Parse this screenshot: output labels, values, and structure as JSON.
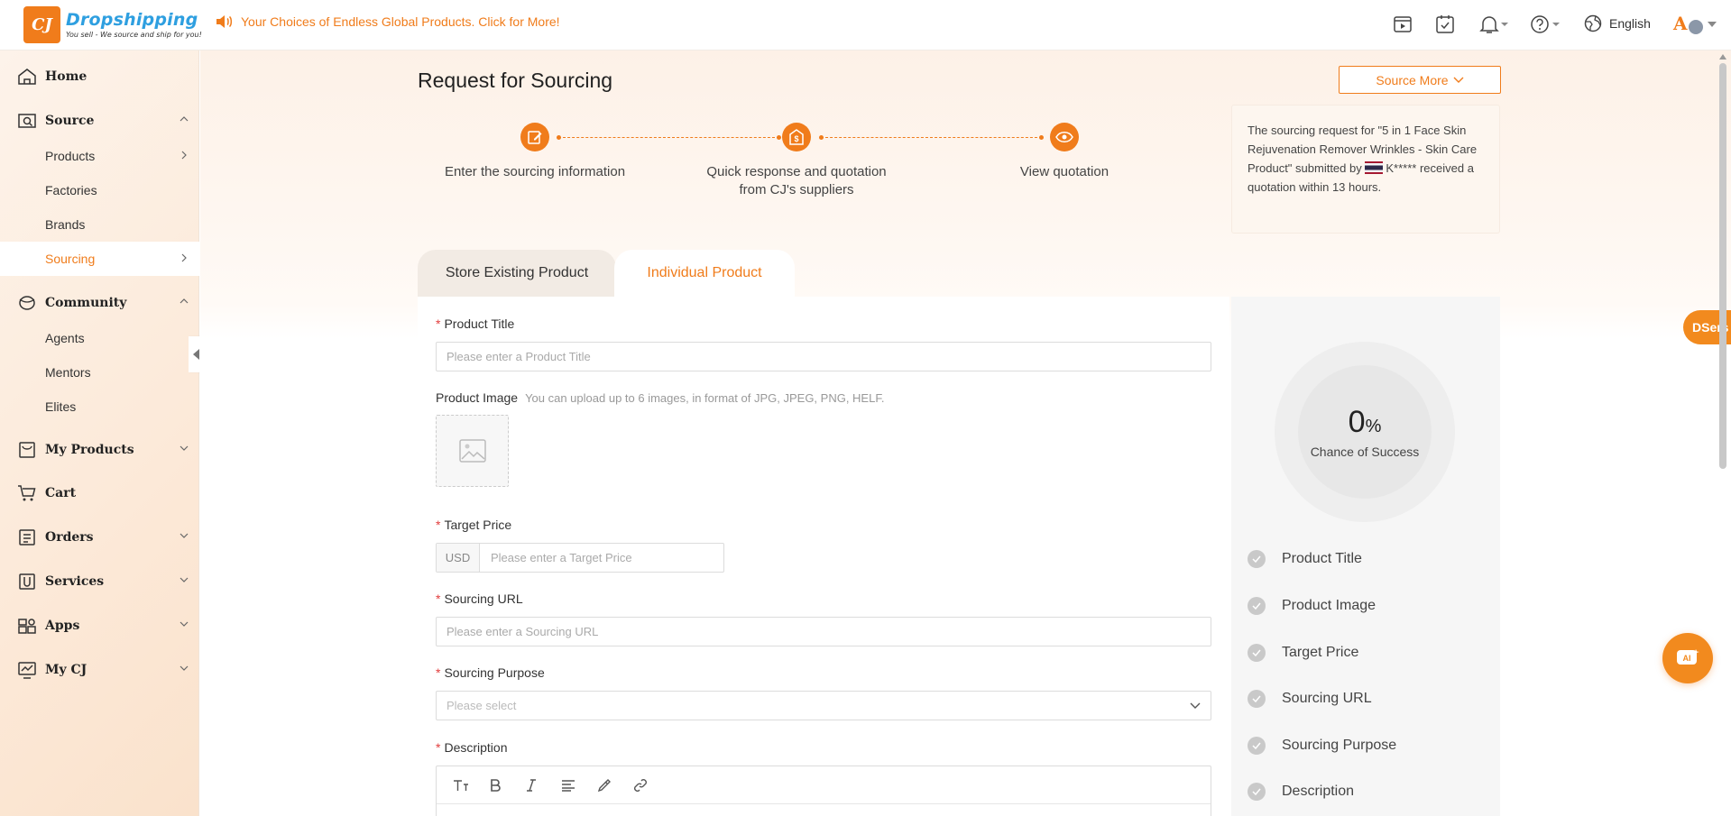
{
  "header": {
    "logo_mark": "CJ",
    "logo_title": "Dropshipping",
    "logo_subtitle": "You sell - We source and ship for you!",
    "announcement": "Your Choices of Endless Global Products. Click for More!",
    "language": "English",
    "avatar_letter": "A"
  },
  "sidebar": {
    "items": [
      {
        "label": "Home"
      },
      {
        "label": "Source"
      },
      {
        "label": "Products"
      },
      {
        "label": "Factories"
      },
      {
        "label": "Brands"
      },
      {
        "label": "Sourcing"
      },
      {
        "label": "Community"
      },
      {
        "label": "Agents"
      },
      {
        "label": "Mentors"
      },
      {
        "label": "Elites"
      },
      {
        "label": "My Products"
      },
      {
        "label": "Cart"
      },
      {
        "label": "Orders"
      },
      {
        "label": "Services"
      },
      {
        "label": "Apps"
      },
      {
        "label": "My CJ"
      }
    ],
    "active_item": "Sourcing"
  },
  "page": {
    "title": "Request for Sourcing",
    "source_more": "Source More",
    "steps": [
      {
        "line1": "Enter the sourcing information",
        "line2": ""
      },
      {
        "line1": "Quick response and quotation",
        "line2": "from CJ's suppliers"
      },
      {
        "line1": "View quotation",
        "line2": ""
      }
    ],
    "notice": {
      "before_flag": "The sourcing request for \"5 in 1 Face Skin Rejuvenation Remover Wrinkles - Skin Care Product\" submitted by",
      "user": "K*****",
      "after": "received a quotation within 13 hours."
    },
    "tabs": [
      {
        "label": "Store Existing Product",
        "active": false
      },
      {
        "label": "Individual Product",
        "active": true
      }
    ]
  },
  "form": {
    "product_title": {
      "label": "Product Title",
      "placeholder": "Please enter a Product Title"
    },
    "product_image": {
      "label": "Product Image",
      "hint": "You can upload up to 6 images, in format of JPG, JPEG, PNG, HELF."
    },
    "target_price": {
      "label": "Target Price",
      "currency": "USD",
      "placeholder": "Please enter a Target Price"
    },
    "sourcing_url": {
      "label": "Sourcing URL",
      "placeholder": "Please enter a Sourcing URL"
    },
    "sourcing_purpose": {
      "label": "Sourcing Purpose",
      "placeholder": "Please select"
    },
    "description": {
      "label": "Description"
    },
    "required_mark": "*"
  },
  "progress": {
    "value": "0",
    "unit": "%",
    "label": "Chance of Success",
    "checklist": [
      "Product Title",
      "Product Image",
      "Target Price",
      "Sourcing URL",
      "Sourcing Purpose",
      "Description"
    ]
  },
  "floating": {
    "dsers": "DSers",
    "ai": "AI"
  },
  "colors": {
    "accent": "#f07c1b",
    "brand_blue": "#2e9fe0",
    "required": "#e23d3d"
  }
}
